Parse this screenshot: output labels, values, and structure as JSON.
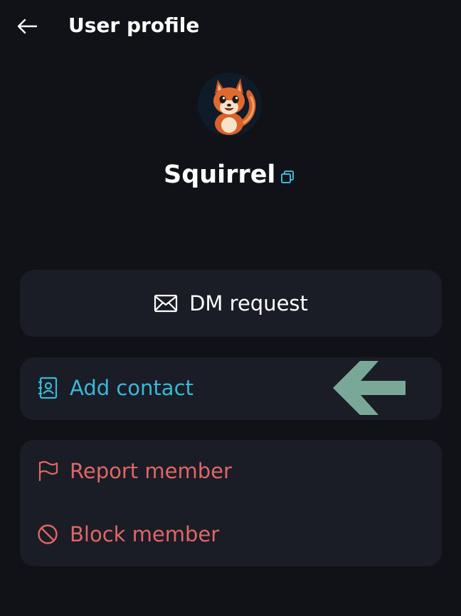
{
  "header": {
    "title": "User profile"
  },
  "profile": {
    "name": "Squirrel"
  },
  "actions": {
    "dm_request": "DM request",
    "add_contact": "Add contact",
    "report_member": "Report member",
    "block_member": "Block member"
  },
  "icons": {
    "back": "arrow-left-icon",
    "copy": "copy-icon",
    "dm": "envelope-icon",
    "contact": "contact-book-icon",
    "report": "flag-icon",
    "block": "block-icon",
    "pointer": "arrow-left-annotation"
  },
  "colors": {
    "background": "#101217",
    "card": "#1a1d26",
    "accent": "#39b8d8",
    "danger": "#e06666",
    "annotation_arrow": "#7aa898"
  }
}
